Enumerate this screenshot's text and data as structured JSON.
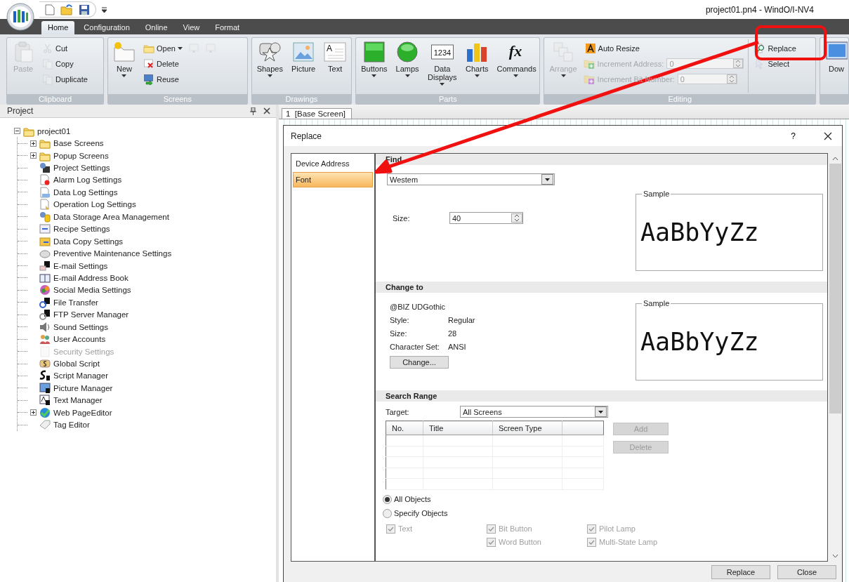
{
  "app": {
    "title": "project01.pn4 - WindO/I-NV4"
  },
  "menu_tabs": [
    {
      "label": "Home",
      "selected": true
    },
    {
      "label": "Configuration",
      "selected": false
    },
    {
      "label": "Online",
      "selected": false
    },
    {
      "label": "View",
      "selected": false
    },
    {
      "label": "Format",
      "selected": false
    }
  ],
  "ribbon": [
    {
      "label": "Clipboard",
      "columns": [
        {
          "kind": "large",
          "label": "Paste",
          "disabled": true,
          "has_menu": false
        },
        {
          "kind": "stack",
          "items": [
            {
              "kind": "button",
              "label": "Cut",
              "disabled": true,
              "has_menu": false
            },
            {
              "kind": "button",
              "label": "Copy",
              "disabled": true,
              "has_menu": false
            },
            {
              "kind": "button",
              "label": "Duplicate",
              "disabled": true,
              "has_menu": false
            }
          ]
        }
      ]
    },
    {
      "label": "Screens",
      "columns": [
        {
          "kind": "large",
          "label": "New",
          "disabled": false,
          "has_menu": true
        },
        {
          "kind": "stack",
          "items": [
            {
              "kind": "button",
              "label": "Open",
              "disabled": false,
              "has_menu": true
            },
            {
              "kind": "button",
              "label": "Delete",
              "disabled": false,
              "has_menu": false
            },
            {
              "kind": "button",
              "label": "Reuse",
              "disabled": false,
              "has_menu": false
            }
          ]
        },
        {
          "kind": "icons",
          "items": [
            {
              "disabled": true
            },
            {
              "disabled": true
            }
          ]
        }
      ]
    },
    {
      "label": "Drawings",
      "columns": [
        {
          "kind": "large",
          "label": "Shapes",
          "disabled": false,
          "has_menu": true
        },
        {
          "kind": "large",
          "label": "Picture",
          "disabled": false,
          "has_menu": false
        },
        {
          "kind": "large",
          "label": "Text",
          "icon_text": "A",
          "disabled": false,
          "has_menu": false
        }
      ]
    },
    {
      "label": "Parts",
      "columns": [
        {
          "kind": "large",
          "label": "Buttons",
          "disabled": false,
          "has_menu": true
        },
        {
          "kind": "large",
          "label": "Lamps",
          "disabled": false,
          "has_menu": true
        },
        {
          "kind": "large",
          "label": "Data Displays",
          "icon_text": "1234",
          "disabled": false,
          "has_menu": true
        },
        {
          "kind": "large",
          "label": "Charts",
          "disabled": false,
          "has_menu": true
        },
        {
          "kind": "large",
          "label": "Commands",
          "icon_text": "fx",
          "disabled": false,
          "has_menu": true
        }
      ]
    },
    {
      "label": "Editing",
      "columns": [
        {
          "kind": "large",
          "label": "Arrange",
          "disabled": true,
          "has_menu": true
        },
        {
          "kind": "stack",
          "items": [
            {
              "kind": "button",
              "label": "Auto Resize",
              "disabled": false,
              "has_menu": false
            },
            {
              "kind": "spin",
              "label": "Increment Address:",
              "value": "0",
              "disabled": true
            },
            {
              "kind": "spin",
              "label": "Increment Bit Number:",
              "value": "0",
              "disabled": true
            }
          ]
        },
        {
          "kind": "stack",
          "items": [
            {
              "kind": "button",
              "label": "Replace",
              "disabled": false,
              "has_menu": false
            },
            {
              "kind": "button",
              "label": "Select",
              "disabled": true,
              "has_menu": false
            }
          ]
        }
      ]
    },
    {
      "columns": [
        {
          "kind": "large",
          "label": "Dow",
          "disabled": false,
          "has_menu": false
        }
      ]
    }
  ],
  "project_panel": {
    "title": "Project",
    "tree": [
      {
        "label": "project01",
        "disabled": false,
        "expanded": true,
        "children": [
          {
            "label": "Base Screens",
            "disabled": false,
            "expanded": false
          },
          {
            "label": "Popup Screens",
            "disabled": false,
            "expanded": false
          },
          {
            "label": "Project Settings",
            "disabled": false
          },
          {
            "label": "Alarm Log Settings",
            "disabled": false
          },
          {
            "label": "Data Log Settings",
            "disabled": false
          },
          {
            "label": "Operation Log Settings",
            "disabled": false
          },
          {
            "label": "Data Storage Area Management",
            "disabled": false
          },
          {
            "label": "Recipe Settings",
            "disabled": false
          },
          {
            "label": "Data Copy Settings",
            "disabled": false
          },
          {
            "label": "Preventive Maintenance Settings",
            "disabled": false
          },
          {
            "label": "E-mail Settings",
            "disabled": false
          },
          {
            "label": "E-mail Address Book",
            "disabled": false
          },
          {
            "label": "Social Media Settings",
            "disabled": false
          },
          {
            "label": "File Transfer",
            "disabled": false
          },
          {
            "label": "FTP Server Manager",
            "disabled": false
          },
          {
            "label": "Sound Settings",
            "disabled": false
          },
          {
            "label": "User Accounts",
            "disabled": false
          },
          {
            "label": "Security Settings",
            "disabled": true
          },
          {
            "label": "Global Script",
            "disabled": false
          },
          {
            "label": "Script Manager",
            "disabled": false
          },
          {
            "label": "Picture Manager",
            "disabled": false
          },
          {
            "label": "Text Manager",
            "disabled": false
          },
          {
            "label": "Web PageEditor",
            "disabled": false,
            "expanded": false
          },
          {
            "label": "Tag Editor",
            "disabled": false
          }
        ]
      }
    ]
  },
  "document_tabs": [
    {
      "label": "1  [Base Screen]",
      "selected": true
    }
  ],
  "dialog": {
    "title": "Replace",
    "help_label": "?",
    "nav": [
      {
        "label": "Device Address",
        "selected": false
      },
      {
        "label": "Font",
        "selected": true
      }
    ],
    "find": {
      "heading": "Find",
      "font_value": "Westem",
      "size_label": "Size:",
      "size_value": "40",
      "sample_label": "Sample",
      "sample_text": "AaBbYyZz"
    },
    "change_to": {
      "heading": "Change to",
      "font_name": "@BIZ UDGothic",
      "props": [
        {
          "label": "Style:",
          "value": "Regular"
        },
        {
          "label": "Size:",
          "value": "28"
        },
        {
          "label": "Character Set:",
          "value": "ANSI"
        }
      ],
      "change_button": "Change...",
      "sample_label": "Sample",
      "sample_text": "AaBbYyZz"
    },
    "search_range": {
      "heading": "Search Range",
      "target_label": "Target:",
      "target_value": "All Screens",
      "table": {
        "columns": [
          "No.",
          "Title",
          "Screen Type"
        ]
      },
      "buttons": [
        {
          "label": "Add",
          "disabled": true
        },
        {
          "label": "Delete",
          "disabled": true
        }
      ],
      "scope": [
        {
          "label": "All Objects",
          "selected": true
        },
        {
          "label": "Specify Objects",
          "selected": false
        }
      ],
      "objects": [
        [
          {
            "label": "Text",
            "checked": true,
            "disabled": true
          }
        ],
        [
          {
            "label": "Bit Button",
            "checked": true,
            "disabled": true
          },
          {
            "label": "Word Button",
            "checked": true,
            "disabled": true
          }
        ],
        [
          {
            "label": "Pilot Lamp",
            "checked": true,
            "disabled": true
          },
          {
            "label": "Multi-State Lamp",
            "checked": true,
            "disabled": true
          }
        ]
      ]
    },
    "footer_buttons": [
      {
        "label": "Replace"
      },
      {
        "label": "Close"
      }
    ]
  }
}
